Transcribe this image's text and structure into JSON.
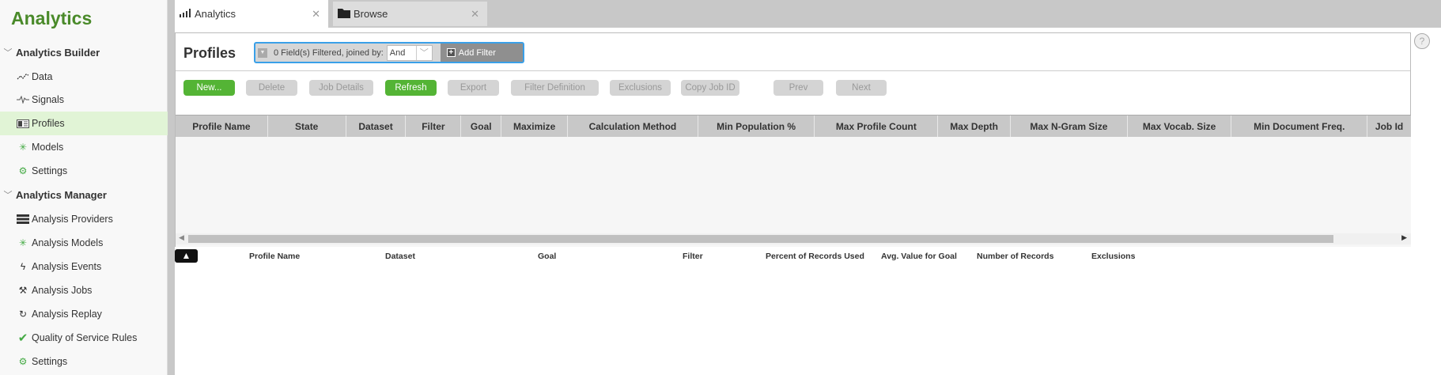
{
  "sidebar": {
    "title": "Analytics",
    "sections": [
      {
        "label": "Analytics Builder",
        "items": [
          {
            "label": "Data",
            "icon": "data-icon"
          },
          {
            "label": "Signals",
            "icon": "signals-icon"
          },
          {
            "label": "Profiles",
            "icon": "profiles-icon"
          },
          {
            "label": "Models",
            "icon": "models-icon"
          },
          {
            "label": "Settings",
            "icon": "gear-icon"
          }
        ]
      },
      {
        "label": "Analytics Manager",
        "items": [
          {
            "label": "Analysis Providers",
            "icon": "server-icon"
          },
          {
            "label": "Analysis Models",
            "icon": "models-icon"
          },
          {
            "label": "Analysis Events",
            "icon": "lightning-icon"
          },
          {
            "label": "Analysis Jobs",
            "icon": "tools-icon"
          },
          {
            "label": "Analysis Replay",
            "icon": "replay-icon"
          },
          {
            "label": "Quality of Service Rules",
            "icon": "check-icon"
          },
          {
            "label": "Settings",
            "icon": "gear-icon"
          }
        ]
      }
    ]
  },
  "tabs": [
    {
      "label": "Analytics"
    },
    {
      "label": "Browse"
    }
  ],
  "page": {
    "title": "Profiles",
    "filter": {
      "summary": "0 Field(s) Filtered, joined by:",
      "join": "And",
      "add": "Add Filter"
    }
  },
  "toolbar": {
    "new": "New...",
    "delete": "Delete",
    "job_details": "Job Details",
    "refresh": "Refresh",
    "export": "Export",
    "filter_definition": "Filter Definition",
    "exclusions": "Exclusions",
    "copy_job_id": "Copy Job ID",
    "prev": "Prev",
    "next": "Next"
  },
  "grid": {
    "columns": [
      "Profile Name",
      "State",
      "Dataset",
      "Filter",
      "Goal",
      "Maximize",
      "Calculation Method",
      "Min Population %",
      "Max Profile Count",
      "Max Depth",
      "Max N-Gram Size",
      "Max Vocab. Size",
      "Min Document Freq.",
      "Job Id"
    ]
  },
  "details": {
    "columns": [
      "Profile Name",
      "Dataset",
      "Goal",
      "Filter",
      "Percent of Records Used",
      "Avg. Value for Goal",
      "Number of Records",
      "Exclusions"
    ]
  },
  "colors": {
    "brand": "#4a8a2a",
    "primary_button": "#54b435",
    "active_item": "#e1f4d6"
  }
}
